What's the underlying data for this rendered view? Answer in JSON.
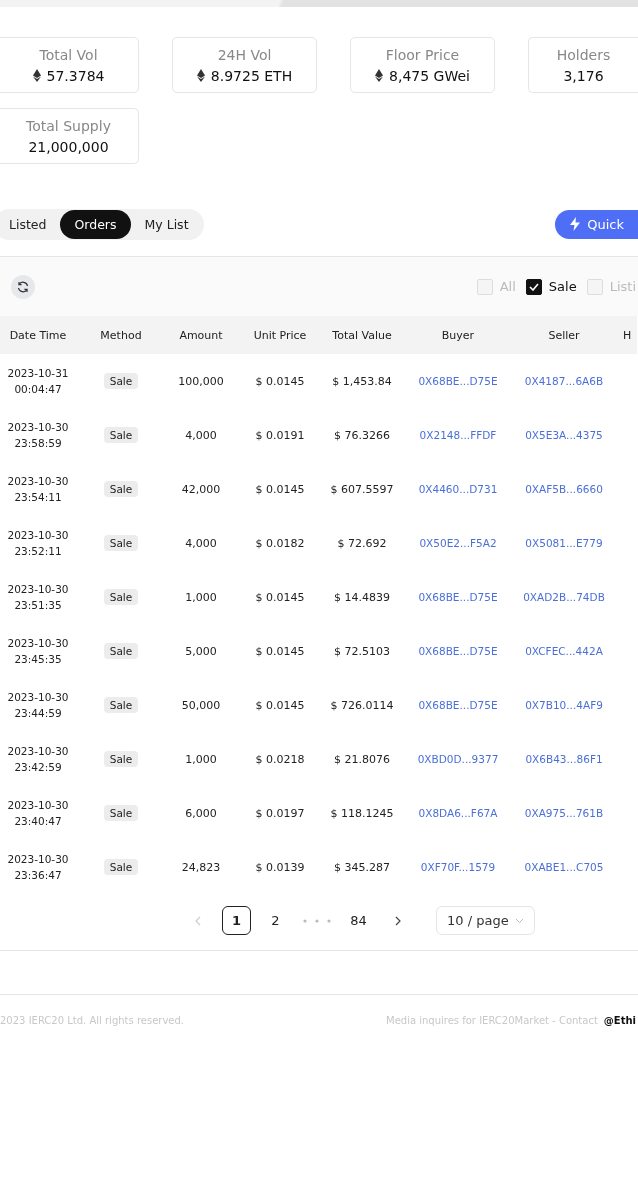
{
  "stats": [
    {
      "label": "Total Vol",
      "value": "57.3784",
      "eth_icon": true
    },
    {
      "label": "24H Vol",
      "value": "8.9725 ETH",
      "eth_icon": true
    },
    {
      "label": "Floor Price",
      "value": "8,475 GWei",
      "eth_icon": true
    },
    {
      "label": "Holders",
      "value": "3,176",
      "eth_icon": false
    },
    {
      "label": "Total Supply",
      "value": "21,000,000",
      "eth_icon": false
    }
  ],
  "tabs": [
    {
      "label": "Listed",
      "selected": false
    },
    {
      "label": "Orders",
      "selected": true
    },
    {
      "label": "My List",
      "selected": false
    }
  ],
  "quick_button": {
    "label": "Quick"
  },
  "filters": [
    {
      "label": "All",
      "checked": false
    },
    {
      "label": "Sale",
      "checked": true
    },
    {
      "label": "Listi",
      "checked": false
    }
  ],
  "table": {
    "columns": [
      "Date Time",
      "Method",
      "Amount",
      "Unit Price",
      "Total Value",
      "Buyer",
      "Seller",
      "H"
    ],
    "rows": [
      {
        "date_time": "2023-10-31 00:04:47",
        "method": "Sale",
        "amount": "100,000",
        "unit_price": "$ 0.0145",
        "total_value": "$ 1,453.84",
        "buyer": "0X68BE...D75E",
        "seller": "0X4187...6A6B"
      },
      {
        "date_time": "2023-10-30 23:58:59",
        "method": "Sale",
        "amount": "4,000",
        "unit_price": "$ 0.0191",
        "total_value": "$ 76.3266",
        "buyer": "0X2148...FFDF",
        "seller": "0X5E3A...4375"
      },
      {
        "date_time": "2023-10-30 23:54:11",
        "method": "Sale",
        "amount": "42,000",
        "unit_price": "$ 0.0145",
        "total_value": "$ 607.5597",
        "buyer": "0X4460...D731",
        "seller": "0XAF5B...6660"
      },
      {
        "date_time": "2023-10-30 23:52:11",
        "method": "Sale",
        "amount": "4,000",
        "unit_price": "$ 0.0182",
        "total_value": "$ 72.692",
        "buyer": "0X50E2...F5A2",
        "seller": "0X5081...E779"
      },
      {
        "date_time": "2023-10-30 23:51:35",
        "method": "Sale",
        "amount": "1,000",
        "unit_price": "$ 0.0145",
        "total_value": "$ 14.4839",
        "buyer": "0X68BE...D75E",
        "seller": "0XAD2B...74DB"
      },
      {
        "date_time": "2023-10-30 23:45:35",
        "method": "Sale",
        "amount": "5,000",
        "unit_price": "$ 0.0145",
        "total_value": "$ 72.5103",
        "buyer": "0X68BE...D75E",
        "seller": "0XCFEC...442A"
      },
      {
        "date_time": "2023-10-30 23:44:59",
        "method": "Sale",
        "amount": "50,000",
        "unit_price": "$ 0.0145",
        "total_value": "$ 726.0114",
        "buyer": "0X68BE...D75E",
        "seller": "0X7B10...4AF9"
      },
      {
        "date_time": "2023-10-30 23:42:59",
        "method": "Sale",
        "amount": "1,000",
        "unit_price": "$ 0.0218",
        "total_value": "$ 21.8076",
        "buyer": "0XBD0D...9377",
        "seller": "0X6B43...86F1"
      },
      {
        "date_time": "2023-10-30 23:40:47",
        "method": "Sale",
        "amount": "6,000",
        "unit_price": "$ 0.0197",
        "total_value": "$ 118.1245",
        "buyer": "0X8DA6...F67A",
        "seller": "0XA975...761B"
      },
      {
        "date_time": "2023-10-30 23:36:47",
        "method": "Sale",
        "amount": "24,823",
        "unit_price": "$ 0.0139",
        "total_value": "$ 345.287",
        "buyer": "0XF70F...1579",
        "seller": "0XABE1...C705"
      }
    ]
  },
  "pagination": {
    "prev_disabled": true,
    "pages": [
      {
        "label": "1",
        "selected": true
      },
      {
        "label": "2",
        "selected": false
      },
      {
        "kind": "ellipsis"
      },
      {
        "label": "84",
        "selected": false
      }
    ],
    "page_size": "10 / page"
  },
  "footer": {
    "copyright": "2023 IERC20 Ltd. All rights reserved.",
    "media_text": "Media inquires for IERC20Market - Contact",
    "handle": "@Ethi"
  }
}
